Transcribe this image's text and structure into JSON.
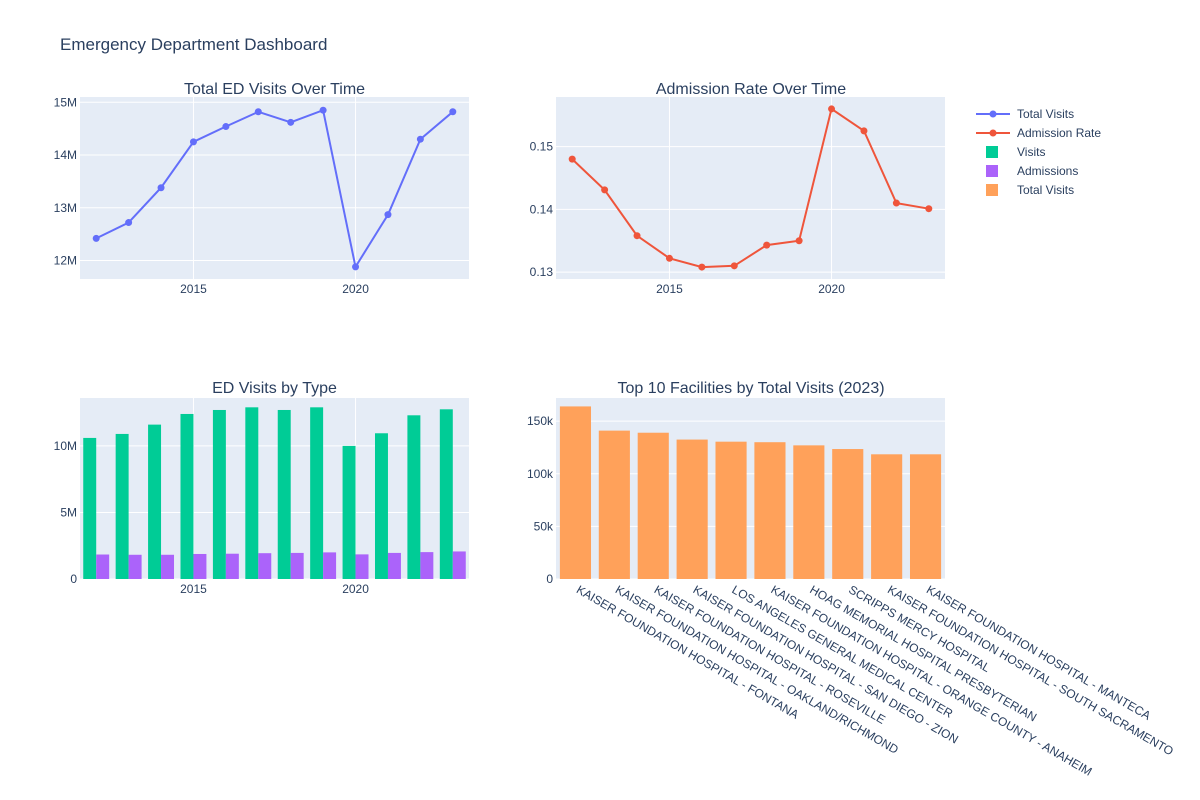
{
  "dashboard": {
    "title": "Emergency Department Dashboard"
  },
  "legend": {
    "items": [
      {
        "label": "Total Visits",
        "kind": "line",
        "color": "#636efa"
      },
      {
        "label": "Admission Rate",
        "kind": "line",
        "color": "#ef553b"
      },
      {
        "label": "Visits",
        "kind": "box",
        "color": "#00cc96"
      },
      {
        "label": "Admissions",
        "kind": "box",
        "color": "#ab63fa"
      },
      {
        "label": "Total Visits",
        "kind": "box",
        "color": "#ffa15a"
      }
    ]
  },
  "chart_data": [
    {
      "type": "line",
      "title": "Total ED Visits Over Time",
      "series": [
        {
          "name": "Total Visits",
          "color": "#636efa",
          "x": [
            2012,
            2013,
            2014,
            2015,
            2016,
            2017,
            2018,
            2019,
            2020,
            2021,
            2022,
            2023
          ],
          "values": [
            12.42,
            12.72,
            13.38,
            14.25,
            14.54,
            14.82,
            14.62,
            14.85,
            11.88,
            12.87,
            14.3,
            14.82
          ]
        }
      ],
      "value_unit": "millions",
      "xlim": [
        2011.5,
        2023.5
      ],
      "ylim": [
        11.65,
        15.1
      ],
      "xticks": [
        2015,
        2020
      ],
      "yticks": [
        12,
        13,
        14,
        15
      ],
      "ytick_labels": [
        "12M",
        "13M",
        "14M",
        "15M"
      ],
      "xlabel": "",
      "ylabel": "",
      "grid": true
    },
    {
      "type": "line",
      "title": "Admission Rate Over Time",
      "series": [
        {
          "name": "Admission Rate",
          "color": "#ef553b",
          "x": [
            2012,
            2013,
            2014,
            2015,
            2016,
            2017,
            2018,
            2019,
            2020,
            2021,
            2022,
            2023
          ],
          "values": [
            0.148,
            0.1431,
            0.1358,
            0.1322,
            0.1308,
            0.131,
            0.1343,
            0.135,
            0.156,
            0.1525,
            0.141,
            0.1401
          ]
        }
      ],
      "xlim": [
        2011.5,
        2023.5
      ],
      "ylim": [
        0.1289,
        0.1579
      ],
      "xticks": [
        2015,
        2020
      ],
      "yticks": [
        0.13,
        0.14,
        0.15
      ],
      "ytick_labels": [
        "0.13",
        "0.14",
        "0.15"
      ],
      "xlabel": "",
      "ylabel": "",
      "grid": true
    },
    {
      "type": "bar",
      "title": "ED Visits by Type",
      "x": [
        2012,
        2013,
        2014,
        2015,
        2016,
        2017,
        2018,
        2019,
        2020,
        2021,
        2022,
        2023
      ],
      "series": [
        {
          "name": "Visits",
          "color": "#00cc96",
          "values": [
            10.6,
            10.9,
            11.6,
            12.4,
            12.7,
            12.9,
            12.7,
            12.9,
            10.0,
            10.95,
            12.3,
            12.75
          ]
        },
        {
          "name": "Admissions",
          "color": "#ab63fa",
          "values": [
            1.84,
            1.82,
            1.82,
            1.88,
            1.9,
            1.94,
            1.96,
            2.0,
            1.85,
            1.96,
            2.02,
            2.07
          ]
        }
      ],
      "value_unit": "millions",
      "xlim": [
        2011.5,
        2023.5
      ],
      "ylim": [
        0,
        13.6
      ],
      "xticks": [
        2015,
        2020
      ],
      "yticks": [
        0,
        5,
        10
      ],
      "ytick_labels": [
        "0",
        "5M",
        "10M"
      ],
      "xlabel": "",
      "ylabel": "",
      "grid": true
    },
    {
      "type": "bar",
      "title": "Top 10 Facilities by Total Visits (2023)",
      "categories": [
        "KAISER FOUNDATION HOSPITAL - FONTANA",
        "KAISER FOUNDATION HOSPITAL - OAKLAND/RICHMOND",
        "KAISER FOUNDATION HOSPITAL - ROSEVILLE",
        "KAISER FOUNDATION HOSPITAL - SAN DIEGO - ZION",
        "LOS ANGELES GENERAL MEDICAL CENTER",
        "KAISER FOUNDATION HOSPITAL - ORANGE COUNTY - ANAHEIM",
        "HOAG MEMORIAL HOSPITAL PRESBYTERIAN",
        "SCRIPPS MERCY HOSPITAL",
        "KAISER FOUNDATION HOSPITAL - SOUTH SACRAMENTO",
        "KAISER FOUNDATION HOSPITAL - MANTECA"
      ],
      "series": [
        {
          "name": "Total Visits",
          "color": "#ffa15a",
          "values": [
            164000,
            141000,
            139000,
            132500,
            130500,
            130000,
            127000,
            123500,
            118500,
            118500
          ]
        }
      ],
      "ylim": [
        0,
        172000
      ],
      "yticks": [
        0,
        50000,
        100000,
        150000
      ],
      "ytick_labels": [
        "0",
        "50k",
        "100k",
        "150k"
      ],
      "xlabel": "",
      "ylabel": "",
      "grid": true
    }
  ]
}
